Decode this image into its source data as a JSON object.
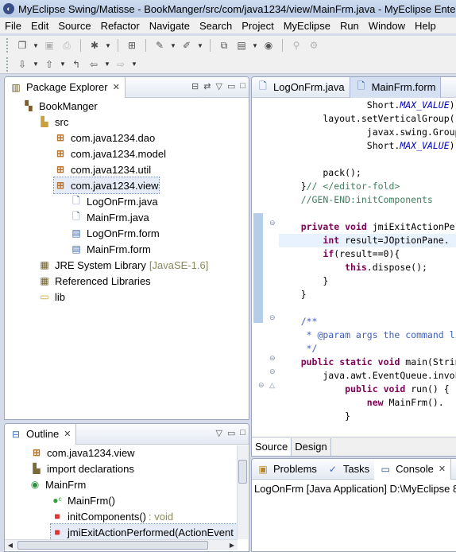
{
  "window": {
    "title": "MyEclipse Swing/Matisse - BookManger/src/com/java1234/view/MainFrm.java - MyEclipse Enterprise Workbench"
  },
  "menu": [
    "File",
    "Edit",
    "Source",
    "Refactor",
    "Navigate",
    "Search",
    "Project",
    "MyEclipse",
    "Run",
    "Window",
    "Help"
  ],
  "package_explorer": {
    "title": "Package Explorer",
    "tree": [
      {
        "label": "BookManger",
        "icon": "project-icon"
      },
      {
        "label": "src",
        "icon": "source-folder-icon"
      },
      {
        "label": "com.java1234.dao",
        "icon": "package-icon"
      },
      {
        "label": "com.java1234.model",
        "icon": "package-icon"
      },
      {
        "label": "com.java1234.util",
        "icon": "package-icon"
      },
      {
        "label": "com.java1234.view",
        "icon": "package-icon"
      },
      {
        "label": "LogOnFrm.java",
        "icon": "java-file-icon"
      },
      {
        "label": "MainFrm.java",
        "icon": "java-file-icon"
      },
      {
        "label": "LogOnFrm.form",
        "icon": "form-file-icon"
      },
      {
        "label": "MainFrm.form",
        "icon": "form-file-icon"
      },
      {
        "label": "JRE System Library",
        "suffix": "[JavaSE-1.6]",
        "icon": "library-icon"
      },
      {
        "label": "Referenced Libraries",
        "icon": "library-icon"
      },
      {
        "label": "lib",
        "icon": "folder-icon"
      }
    ]
  },
  "outline": {
    "title": "Outline",
    "items": [
      {
        "label": "com.java1234.view",
        "icon": "package-icon"
      },
      {
        "label": "import declarations",
        "icon": "imports-icon"
      },
      {
        "label": "MainFrm",
        "icon": "class-icon"
      },
      {
        "label": "MainFrm()",
        "icon": "constructor-icon"
      },
      {
        "label": "initComponents()",
        "suffix": ": void",
        "icon": "private-method-icon"
      },
      {
        "label": "jmiExitActionPerformed(ActionEvent",
        "icon": "private-method-icon"
      }
    ]
  },
  "editor": {
    "tabs": [
      "LogOnFrm.java",
      "MainFrm.form"
    ],
    "bottom_tabs": [
      "Source",
      "Design"
    ]
  },
  "console_panel": {
    "tabs": [
      "Problems",
      "Tasks",
      "Console"
    ],
    "line": "LogOnFrm [Java Application] D:\\MyEclipse 8"
  },
  "colors": {
    "keyword": "#7f0055",
    "comment": "#3f7f5f",
    "javadoc": "#3f5fbf",
    "field": "#0000c0"
  }
}
